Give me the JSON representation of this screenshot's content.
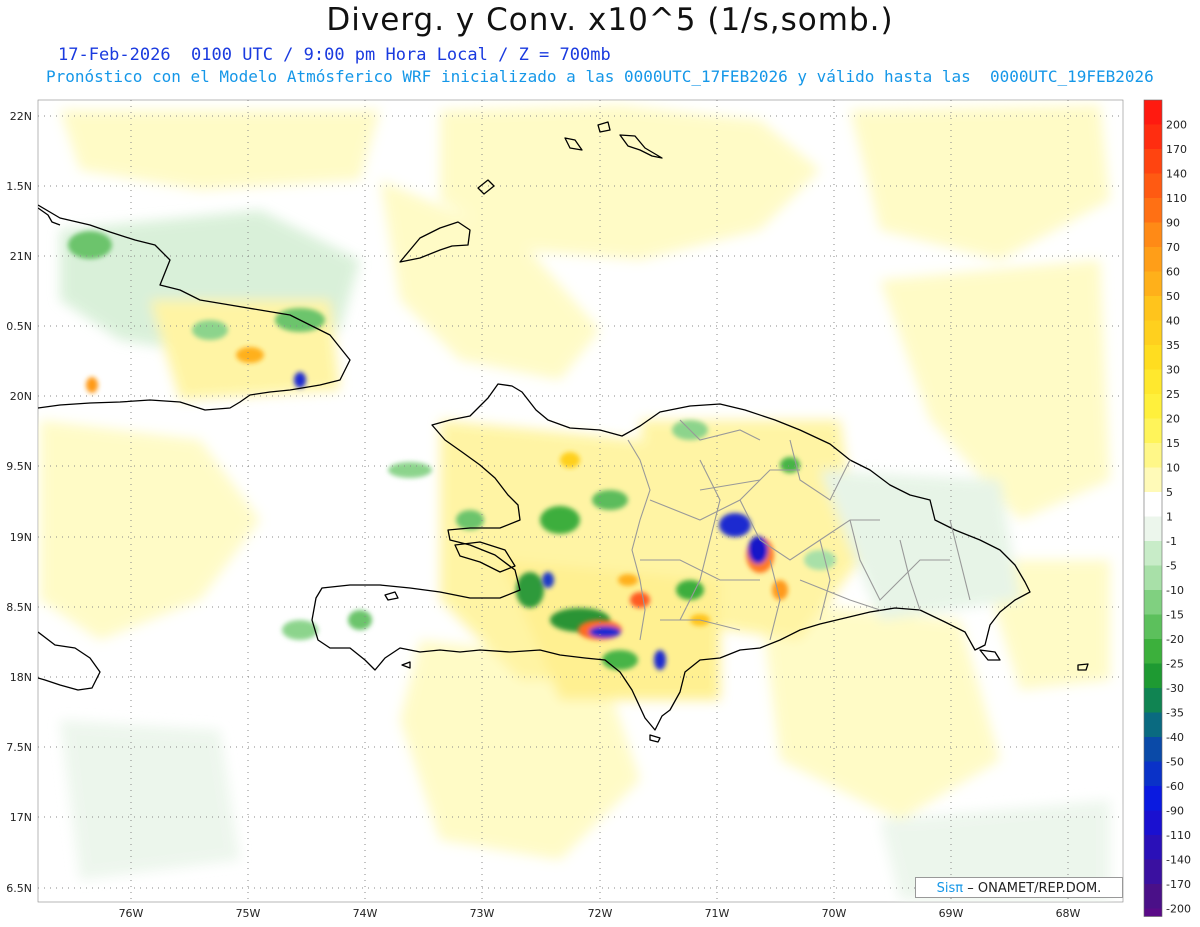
{
  "title": "Diverg. y Conv. x10^5 (1/s,somb.)",
  "subtitle_date": "17-Feb-2026  0100 UTC / 9:00 pm Hora Local / Z = 700mb",
  "subtitle_model": "Pronóstico con el Modelo Atmósferico WRF inicializado a las 0000UTC_17FEB2026 y válido hasta las  0000UTC_19FEB2026",
  "y_axis_labels": [
    "22N",
    "1.5N",
    "21N",
    "0.5N",
    "20N",
    "9.5N",
    "19N",
    "8.5N",
    "18N",
    "7.5N",
    "17N",
    "6.5N"
  ],
  "x_axis_labels": [
    "76W",
    "75W",
    "74W",
    "73W",
    "72W",
    "71W",
    "70W",
    "69W",
    "68W"
  ],
  "colorbar": {
    "labels": [
      "200",
      "170",
      "140",
      "110",
      "90",
      "70",
      "60",
      "50",
      "40",
      "35",
      "30",
      "25",
      "20",
      "15",
      "10",
      "5",
      "1",
      "-1",
      "-5",
      "-10",
      "-15",
      "-20",
      "-25",
      "-30",
      "-35",
      "-40",
      "-50",
      "-60",
      "-90",
      "-110",
      "-140",
      "-170",
      "-200"
    ],
    "colors": [
      "#ff1a10",
      "#ff2d10",
      "#ff4410",
      "#ff5a12",
      "#ff7014",
      "#ff8a16",
      "#ff9e18",
      "#ffb01a",
      "#ffc41c",
      "#ffd01e",
      "#ffdd20",
      "#ffe82e",
      "#fff03c",
      "#fff45a",
      "#fff788",
      "#fffab8",
      "#ffffff",
      "#ecf6ec",
      "#c8ecc8",
      "#a8e0a8",
      "#80d080",
      "#5cc05c",
      "#3cb03c",
      "#1e9a32",
      "#108452",
      "#0a6a80",
      "#0a4aa8",
      "#0a32c8",
      "#0a1ae0",
      "#1a10d0",
      "#2a10b8",
      "#3a10a0",
      "#4a1088"
    ],
    "bottom_color": "#5a0a88"
  },
  "credit": {
    "sis": "Sisπ",
    "rest": "– ONAMET/REP.DOM."
  }
}
